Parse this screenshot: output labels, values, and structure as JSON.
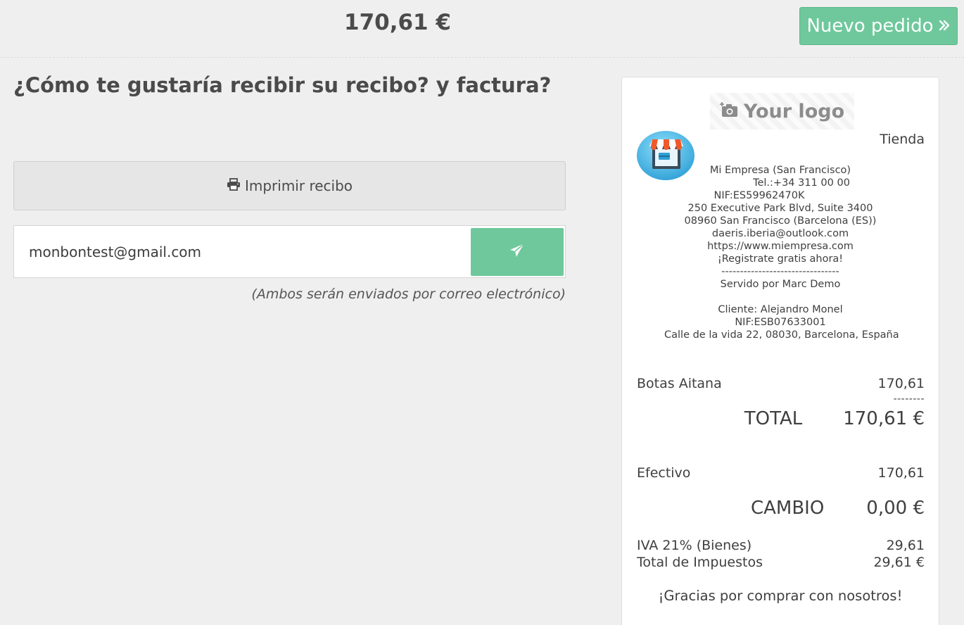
{
  "header": {
    "total": "170,61 €",
    "new_order_label": "Nuevo pedido"
  },
  "main": {
    "question": "¿Cómo te gustaría recibir su recibo? y factura?",
    "print_label": "Imprimir recibo",
    "email_value": "monbontest@gmail.com",
    "email_hint": "(Ambos serán enviados por correo electrónico)"
  },
  "receipt": {
    "logo_text": "Your logo",
    "store_type": "Tienda",
    "company_lines": [
      "Mi Empresa (San Francisco)",
      "Tel.:+34 311 00 00",
      "NIF:ES59962470K",
      "250 Executive Park Blvd, Suite 3400",
      "08960 San Francisco (Barcelona (ES))",
      "daeris.iberia@outlook.com",
      "https://www.miempresa.com",
      "¡Registrate gratis ahora!",
      "--------------------------------",
      "Servido por Marc Demo",
      "",
      "Cliente: Alejandro Monel",
      "NIF:ESB07633001",
      "Calle de la vida 22, 08030, Barcelona, España"
    ],
    "item_name": "Botas Aitana",
    "item_price": "170,61",
    "dashes": "--------",
    "total_label": "TOTAL",
    "total_value": "170,61 €",
    "payment_method": "Efectivo",
    "payment_amount": "170,61",
    "change_label": "CAMBIO",
    "change_value": "0,00 €",
    "tax_label": "IVA 21% (Bienes)",
    "tax_value": "29,61",
    "tax_total_label": "Total de Impuestos",
    "tax_total_value": "29,61 €",
    "thanks": "¡Gracias por comprar con nosotros!"
  },
  "colors": {
    "background": "#f0efef",
    "accent_green": "#6ec89b",
    "button_gray": "#e6e6e6"
  },
  "icons": {
    "new_order": "double-chevron-right-icon",
    "print": "printer-icon",
    "send": "paper-plane-icon",
    "logo": "camera-plus-icon",
    "store": "store-icon"
  }
}
